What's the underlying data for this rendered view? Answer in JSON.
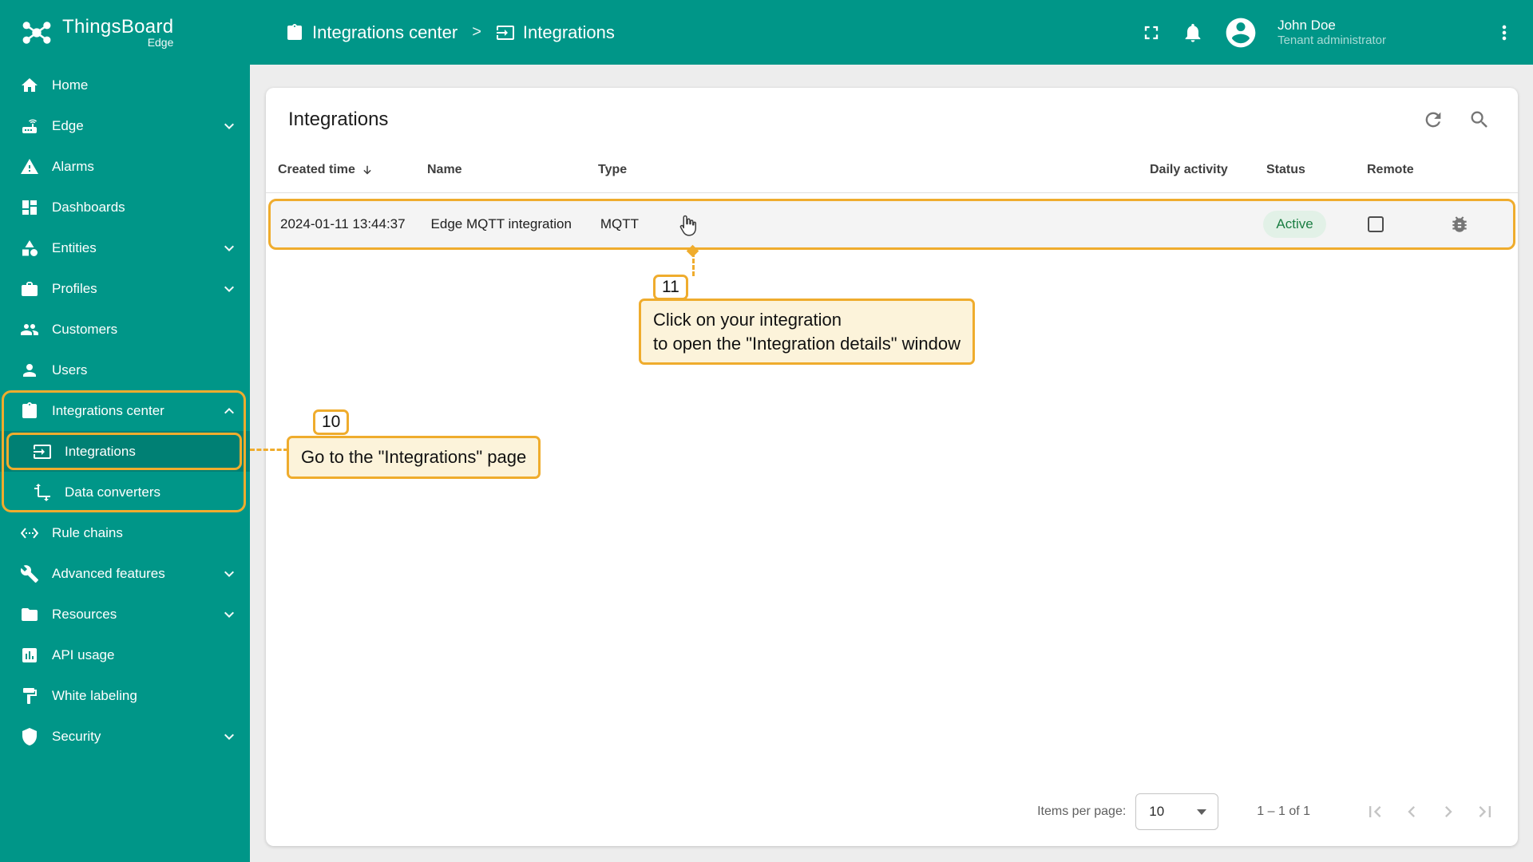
{
  "app": {
    "logo_title": "ThingsBoard",
    "logo_subtitle": "Edge"
  },
  "header": {
    "breadcrumb": [
      {
        "label": "Integrations center"
      },
      {
        "label": "Integrations"
      }
    ],
    "user": {
      "name": "John Doe",
      "role": "Tenant administrator"
    }
  },
  "sidebar": {
    "items": [
      {
        "label": "Home"
      },
      {
        "label": "Edge"
      },
      {
        "label": "Alarms"
      },
      {
        "label": "Dashboards"
      },
      {
        "label": "Entities"
      },
      {
        "label": "Profiles"
      },
      {
        "label": "Customers"
      },
      {
        "label": "Users"
      },
      {
        "label": "Integrations center"
      },
      {
        "label": "Integrations",
        "selected": true
      },
      {
        "label": "Data converters"
      },
      {
        "label": "Rule chains"
      },
      {
        "label": "Advanced features"
      },
      {
        "label": "Resources"
      },
      {
        "label": "API usage"
      },
      {
        "label": "White labeling"
      },
      {
        "label": "Security"
      }
    ]
  },
  "main": {
    "title": "Integrations",
    "table": {
      "columns": [
        "Created time",
        "Name",
        "Type",
        "Daily activity",
        "Status",
        "Remote"
      ],
      "rows": [
        {
          "created_time": "2024-01-11 13:44:37",
          "name": "Edge MQTT integration",
          "type": "MQTT",
          "status": "Active"
        }
      ]
    },
    "pagination": {
      "items_per_page_label": "Items per page:",
      "items_per_page_value": "10",
      "range_label": "1 – 1 of 1"
    }
  },
  "annotations": {
    "step10": {
      "number": "10",
      "text": "Go to the \"Integrations\" page"
    },
    "step11": {
      "number": "11",
      "line1": "Click on your integration",
      "line2": "to open the \"Integration details\" window"
    }
  },
  "colors": {
    "sidebar_teal": "#009688",
    "selected_item_overlay": "rgba(0,0,0,0.14)",
    "annotation_amber": "#EFAC2D",
    "annotation_bg": "#fcf3da",
    "status_active_bg": "#e2f1e7",
    "status_active_text": "#1b7e43"
  }
}
